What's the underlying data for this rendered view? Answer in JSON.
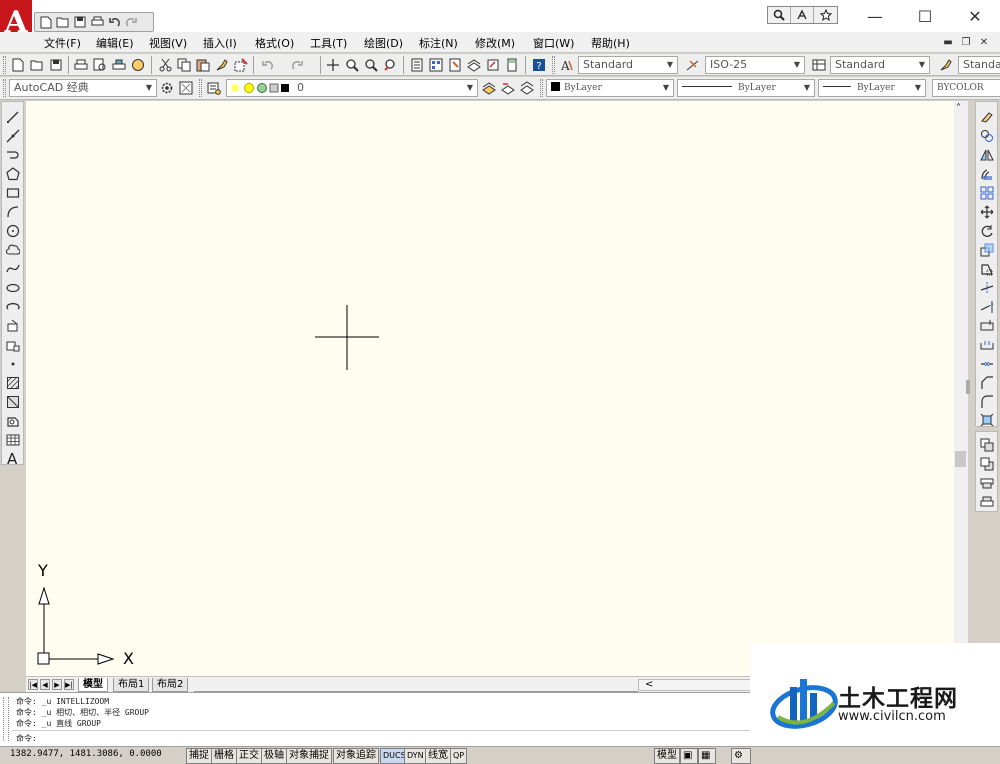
{
  "title_bar": {
    "logo_letter": "A",
    "title": "",
    "window_controls": {
      "minimize": "—",
      "maximize": "☐",
      "close": "✕"
    }
  },
  "menu": {
    "items": [
      "文件(F)",
      "编辑(E)",
      "视图(V)",
      "插入(I)",
      "格式(O)",
      "工具(T)",
      "绘图(D)",
      "标注(N)",
      "修改(M)",
      "窗口(W)",
      "帮助(H)"
    ]
  },
  "toolbar_standard": {
    "text_style": "Standard",
    "dim_style": "ISO-25",
    "table_style": "Standard",
    "multileader_style": "Standa"
  },
  "toolbar_layers": {
    "workspace": "AutoCAD 经典",
    "layer": "0",
    "color": "ByLayer",
    "linetype": "ByLayer",
    "lineweight": "ByLayer",
    "plot_style": "BYCOLOR"
  },
  "ucs": {
    "y_label": "Y",
    "x_label": "X"
  },
  "layout_tabs": [
    "模型",
    "布局1",
    "布局2"
  ],
  "scroll_left_arrow": "<",
  "command_history": [
    "命令: _u INTELLIZOOM",
    "命令: _u 相切、相切、半径 GROUP",
    "命令: _u 直线 GROUP"
  ],
  "command_prompt": "命令:",
  "status": {
    "coordinates": "1382.9477, 1481.3086, 0.0000",
    "toggles": [
      "捕捉",
      "栅格",
      "正交",
      "极轴",
      "对象捕捉",
      "对象追踪",
      "DUCS",
      "DYN",
      "线宽",
      "QP"
    ],
    "model_label": "模型"
  },
  "watermark": {
    "name": "土木工程网",
    "url": "www.civilcn.com"
  }
}
